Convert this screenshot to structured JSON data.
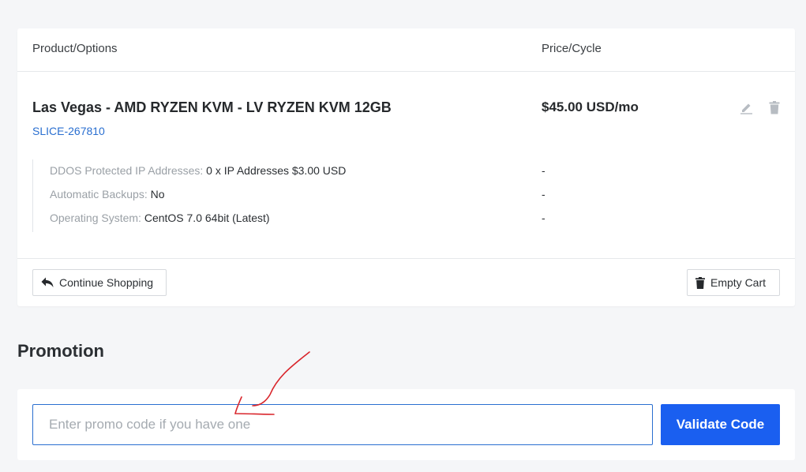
{
  "cart": {
    "header": {
      "product_label": "Product/Options",
      "price_label": "Price/Cycle"
    },
    "item": {
      "title": "Las Vegas - AMD RYZEN KVM - LV RYZEN KVM 12GB",
      "domain": "SLICE-267810",
      "price": "$45.00 USD/mo",
      "options": [
        {
          "label": "DDOS Protected IP Addresses:",
          "value": "0 x IP Addresses $3.00 USD",
          "price": "-"
        },
        {
          "label": "Automatic Backups:",
          "value": "No",
          "price": "-"
        },
        {
          "label": "Operating System:",
          "value": "CentOS 7.0 64bit (Latest)",
          "price": "-"
        }
      ]
    },
    "footer": {
      "continue_label": "Continue Shopping",
      "empty_label": "Empty Cart"
    }
  },
  "promotion": {
    "heading": "Promotion",
    "input_placeholder": "Enter promo code if you have one",
    "validate_label": "Validate Code"
  },
  "colors": {
    "accent": "#1a5ff0",
    "link": "#2a6fd0",
    "annotation": "#d9262c"
  },
  "icons": {
    "edit": "pencil-icon",
    "delete": "trash-icon",
    "back": "reply-arrow-icon"
  }
}
